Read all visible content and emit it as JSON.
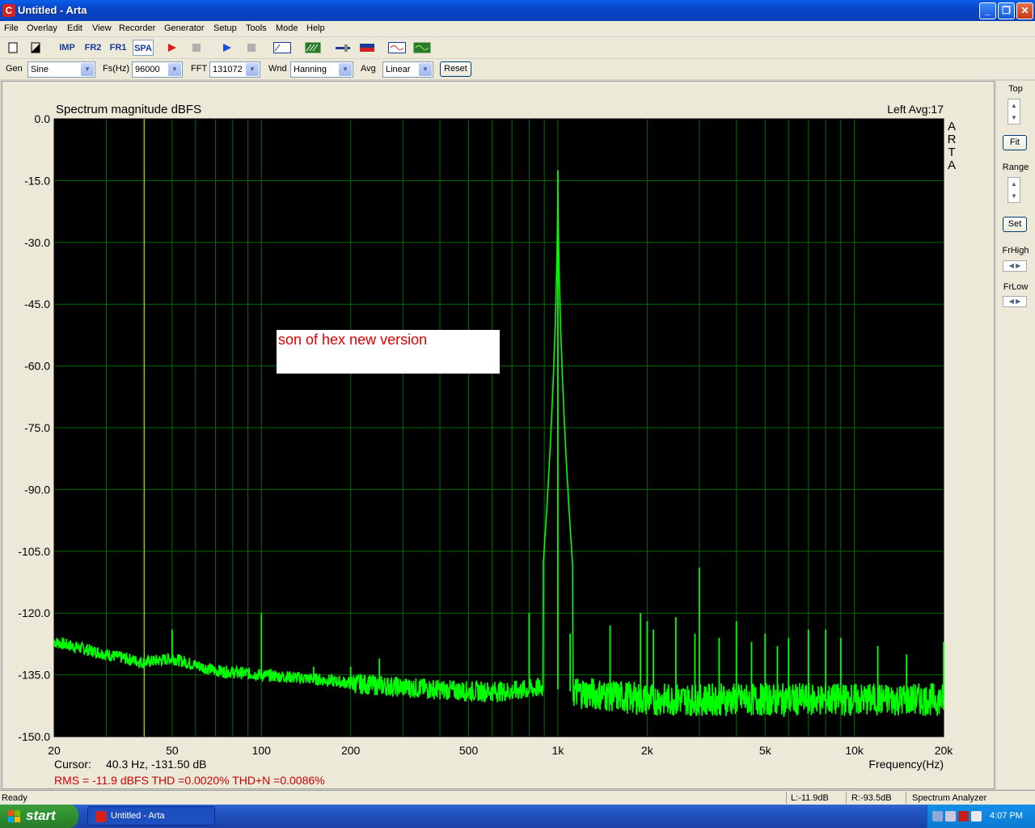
{
  "window": {
    "title": "Untitled - Arta",
    "app_icon": "arta-icon",
    "minimize": "_",
    "maximize": "❐",
    "close": "✕"
  },
  "menu": [
    "File",
    "Overlay",
    "Edit",
    "View",
    "Recorder",
    "Generator",
    "Setup",
    "Tools",
    "Mode",
    "Help"
  ],
  "toolbar": {
    "imp": "IMP",
    "fr2": "FR2",
    "fr1": "FR1",
    "spa": "SPA",
    "icons": [
      "new-document-icon",
      "open-icon",
      "record-icon",
      "stop-icon",
      "play-icon",
      "stop2-icon",
      "abc-icon",
      "chart-icon",
      "slider-icon",
      "level-icon",
      "scope-icon",
      "generator-icon"
    ]
  },
  "controls": {
    "gen_label": "Gen",
    "gen_value": "Sine",
    "fs_label": "Fs(Hz)",
    "fs_value": "96000",
    "fft_label": "FFT",
    "fft_value": "131072",
    "wnd_label": "Wnd",
    "wnd_value": "Hanning",
    "avg_label": "Avg",
    "avg_value": "Linear",
    "reset_label": "Reset"
  },
  "right_panel": {
    "top_label": "Top",
    "fit_label": "Fit",
    "range_label": "Range",
    "set_label": "Set",
    "frhigh_label": "FrHigh",
    "frlow_label": "FrLow"
  },
  "plot": {
    "title": "Spectrum magnitude dBFS",
    "channel_info": "Left  Avg:17",
    "watermark": [
      "A",
      "R",
      "T",
      "A"
    ],
    "xlabel": "Frequency(Hz)",
    "cursor_label": "Cursor:",
    "cursor_value": "40.3 Hz, -131.50 dB",
    "stats": "RMS =  -11.9 dBFS   THD =0.0020%   THD+N =0.0086%",
    "annotation": "son of hex new version",
    "colors": {
      "background": "#000000",
      "grid": "#006c00",
      "trace": "#00ff00",
      "cursor": "#c8c800",
      "stats_text": "#cc0000"
    }
  },
  "chart_data": {
    "type": "line",
    "title": "Spectrum magnitude dBFS",
    "xlabel": "Frequency(Hz)",
    "ylabel": "",
    "xscale": "log",
    "xlim": [
      20,
      20000
    ],
    "ylim": [
      -150,
      0
    ],
    "x_tick_labels": [
      "20",
      "50",
      "100",
      "200",
      "500",
      "1k",
      "2k",
      "5k",
      "10k",
      "20k"
    ],
    "x_tick_values": [
      20,
      50,
      100,
      200,
      500,
      1000,
      2000,
      5000,
      10000,
      20000
    ],
    "y_tick_labels": [
      "0.0",
      "-15.0",
      "-30.0",
      "-45.0",
      "-60.0",
      "-75.0",
      "-90.0",
      "-105.0",
      "-120.0",
      "-135.0",
      "-150.0"
    ],
    "y_tick_values": [
      0,
      -15,
      -30,
      -45,
      -60,
      -75,
      -90,
      -105,
      -120,
      -135,
      -150
    ],
    "cursor_x": 40.3,
    "noise_floor": {
      "x": [
        20,
        30,
        40,
        50,
        70,
        100,
        150,
        200,
        300,
        500,
        700,
        900,
        1100,
        1500,
        2000,
        3000,
        5000,
        10000,
        20000
      ],
      "y": [
        -127,
        -130,
        -132,
        -131,
        -134,
        -135,
        -136,
        -137,
        -138,
        -139,
        -139,
        -138,
        -139,
        -140,
        -141,
        -141,
        -141,
        -141,
        -141
      ]
    },
    "series": [
      {
        "values_peaks": {
          "x": [
            50,
            100,
            150,
            200,
            250,
            800,
            1000,
            1100,
            1500,
            1900,
            2000,
            2100,
            2500,
            2900,
            3000,
            3500,
            4000,
            4500,
            5000,
            5500,
            6000,
            7000,
            8000,
            9000,
            12000,
            15000,
            20000
          ],
          "y": [
            -124,
            -120,
            -133,
            -133,
            -131,
            -120,
            -12.5,
            -125,
            -123,
            -120,
            -122,
            -124,
            -121,
            -125,
            -109,
            -126,
            -122,
            -127,
            -125,
            -128,
            -126,
            -124,
            -124,
            -126,
            -128,
            -130,
            -127
          ]
        }
      }
    ]
  },
  "status": {
    "ready": "Ready",
    "left_level": "L:-11.9dB",
    "right_level": "R:-93.5dB",
    "mode": "Spectrum Analyzer"
  },
  "taskbar": {
    "start_label": "start",
    "task_label": "Untitled - Arta",
    "clock": "4:07 PM"
  }
}
